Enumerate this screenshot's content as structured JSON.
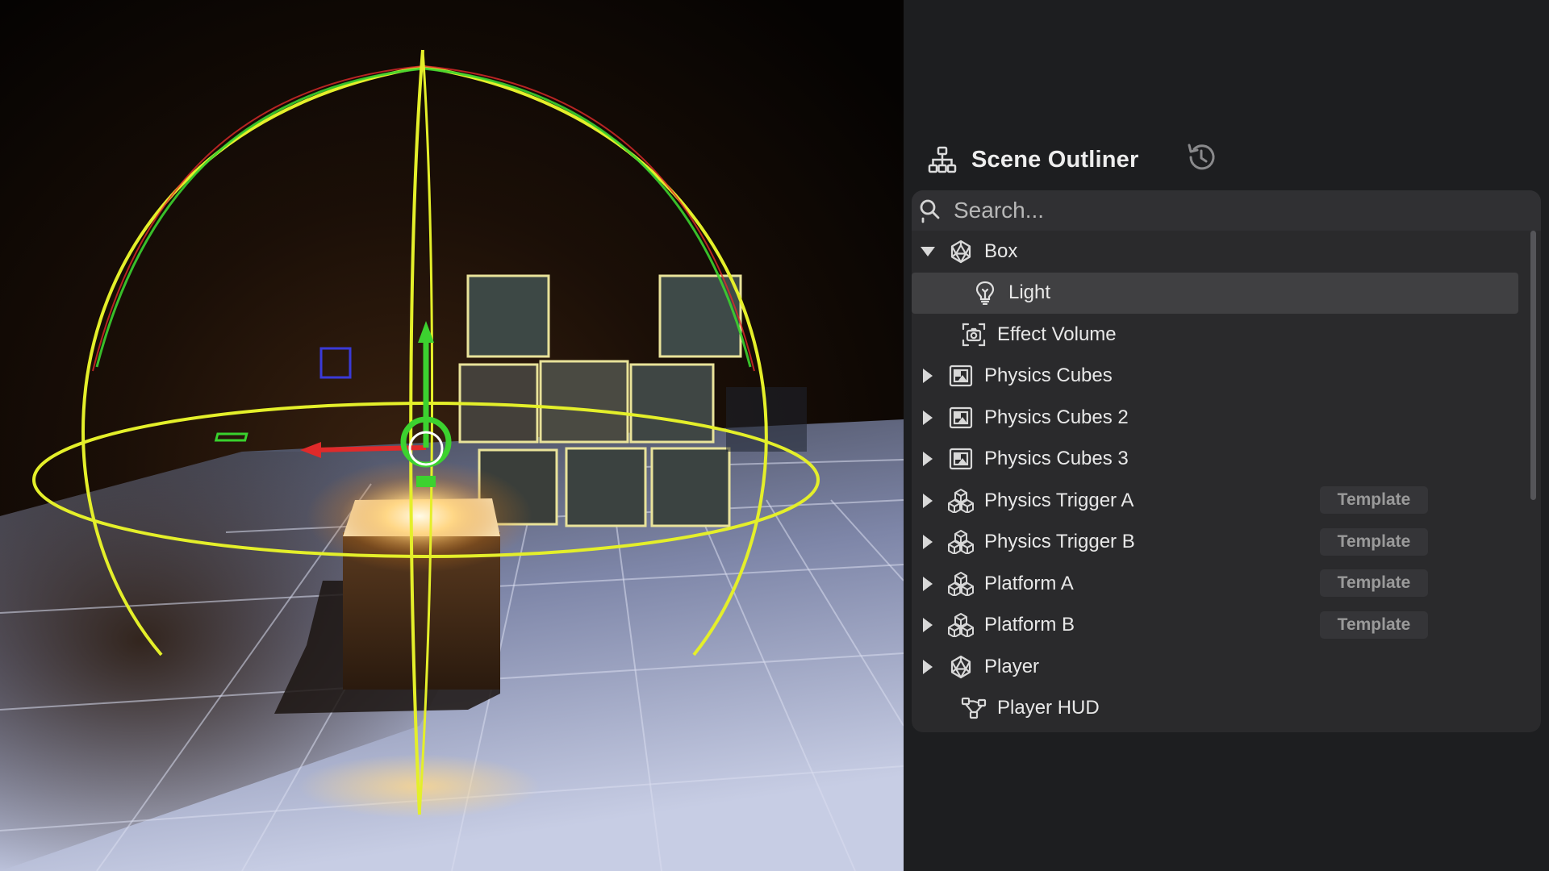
{
  "outliner": {
    "title": "Scene Outliner",
    "header_icon": "hierarchy-icon",
    "history_icon": "history-icon",
    "search": {
      "placeholder": "Search...",
      "value": ""
    },
    "items": [
      {
        "label": "Box",
        "icon": "mesh-icon",
        "caret": "expanded",
        "tag": ""
      },
      {
        "label": "Light",
        "icon": "lightbulb-icon",
        "caret": "none",
        "tag": "",
        "selected": true
      },
      {
        "label": "Effect Volume",
        "icon": "camera-volume-icon",
        "caret": "none",
        "tag": ""
      },
      {
        "label": "Physics Cubes",
        "icon": "image-group-icon",
        "caret": "collapsed",
        "tag": ""
      },
      {
        "label": "Physics Cubes 2",
        "icon": "image-group-icon",
        "caret": "collapsed",
        "tag": ""
      },
      {
        "label": "Physics Cubes 3",
        "icon": "image-group-icon",
        "caret": "collapsed",
        "tag": ""
      },
      {
        "label": "Physics Trigger A",
        "icon": "cubes-icon",
        "caret": "collapsed",
        "tag": "Template"
      },
      {
        "label": "Physics Trigger B",
        "icon": "cubes-icon",
        "caret": "collapsed",
        "tag": "Template"
      },
      {
        "label": "Platform A",
        "icon": "cubes-icon",
        "caret": "collapsed",
        "tag": "Template"
      },
      {
        "label": "Platform B",
        "icon": "cubes-icon",
        "caret": "collapsed",
        "tag": "Template"
      },
      {
        "label": "Player",
        "icon": "mesh-icon",
        "caret": "collapsed",
        "tag": ""
      },
      {
        "label": "Player HUD",
        "icon": "node-graph-icon",
        "caret": "none",
        "tag": ""
      }
    ]
  },
  "colors": {
    "panel_bg": "#1d1e20",
    "list_bg": "#2a2a2c",
    "selected_row": "#404042",
    "gizmo_yellow": "#e4ef2a",
    "gizmo_green": "#3cd22f",
    "gizmo_red": "#e02a2a"
  }
}
